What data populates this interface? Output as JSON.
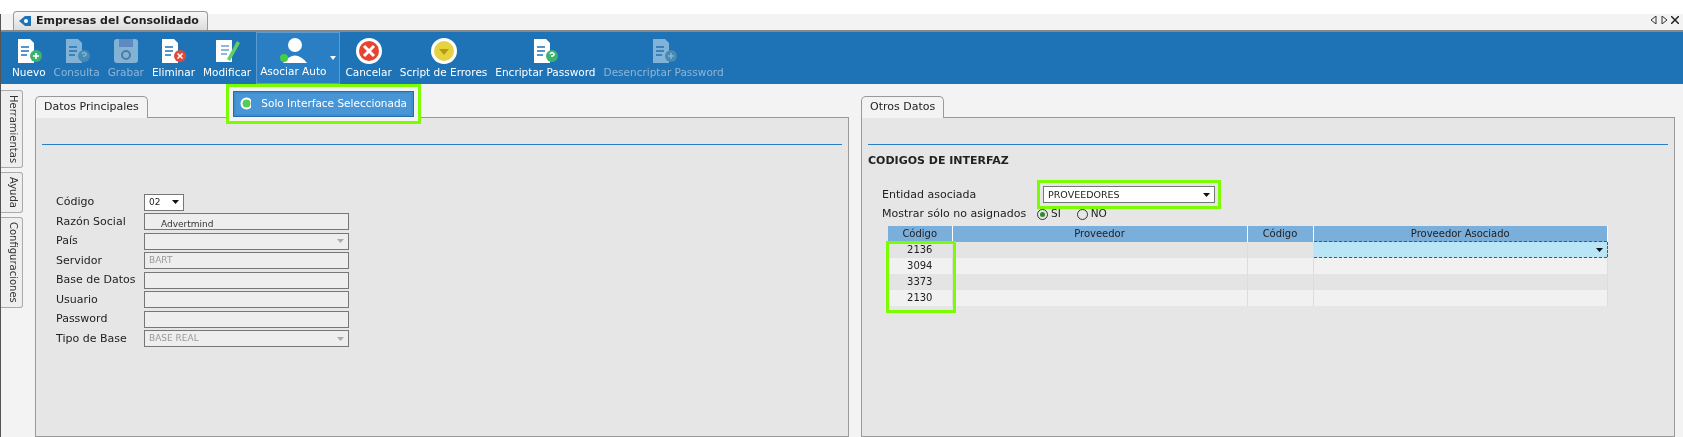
{
  "window": {
    "title": "Empresas del Consolidado"
  },
  "toolbar": [
    {
      "label": "Nuevo",
      "disabled": false
    },
    {
      "label": "Consulta",
      "disabled": true
    },
    {
      "label": "Grabar",
      "disabled": true
    },
    {
      "label": "Eliminar",
      "disabled": false
    },
    {
      "label": "Modificar",
      "disabled": false
    },
    {
      "label": "Asociar Auto",
      "disabled": false,
      "expanded": true
    },
    {
      "label": "Cancelar",
      "disabled": false
    },
    {
      "label": "Script de Errores",
      "disabled": false
    },
    {
      "label": "Encriptar Password",
      "disabled": false
    },
    {
      "label": "Desencriptar Password",
      "disabled": true
    }
  ],
  "dropdown_menu": {
    "items": [
      {
        "label": "Solo Interface Seleccionada",
        "selected": true
      }
    ],
    "highlighted": true
  },
  "side_tabs": [
    {
      "label": "Herramientas"
    },
    {
      "label": "Ayuda"
    },
    {
      "label": "Configuraciones"
    }
  ],
  "left_panel": {
    "tab": "Datos Principales",
    "fields": [
      {
        "label": "Código",
        "kind": "combo",
        "value": "02",
        "disabled": false
      },
      {
        "label": "Razón Social",
        "kind": "text",
        "value": "Advertmind",
        "disabled": true
      },
      {
        "label": "País",
        "kind": "combo",
        "disabled": true
      },
      {
        "label": "Servidor",
        "kind": "text",
        "value": "BART",
        "disabled": true
      },
      {
        "label": "Base de Datos",
        "kind": "text",
        "disabled": true
      },
      {
        "label": "Usuario",
        "kind": "text",
        "disabled": true
      },
      {
        "label": "Password",
        "kind": "text",
        "disabled": true
      },
      {
        "label": "Tipo de Base",
        "kind": "combo",
        "value": "BASE REAL",
        "disabled": true
      }
    ]
  },
  "right_panel": {
    "tab": "Otros Datos",
    "section": "CODIGOS DE INTERFAZ",
    "entity": {
      "label": "Entidad asociada",
      "value": "PROVEEDORES",
      "highlighted": true
    },
    "filter": {
      "label": "Mostrar sólo no asignados",
      "options": [
        {
          "label": "SI",
          "selected": true
        },
        {
          "label": "NO",
          "selected": false
        }
      ]
    },
    "table": {
      "columns": [
        "Código",
        "Proveedor",
        "Código",
        "Proveedor Asociado"
      ],
      "code_column_highlighted": true,
      "rows": [
        {
          "code": "2136",
          "selected": true
        },
        {
          "code": "3094",
          "selected": false
        },
        {
          "code": "3373",
          "selected": false
        },
        {
          "code": "2130",
          "selected": false
        }
      ]
    }
  }
}
